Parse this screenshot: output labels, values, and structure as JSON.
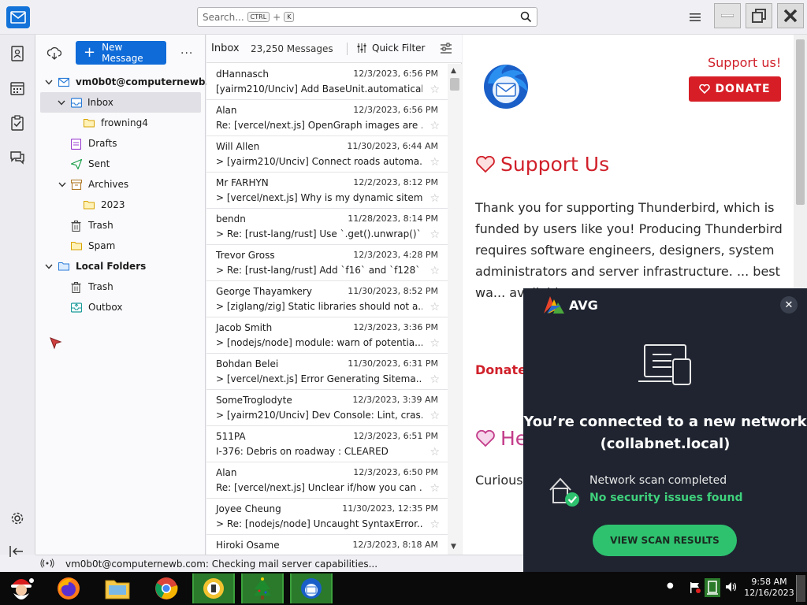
{
  "search": {
    "placeholder": "Search...",
    "key1": "CTRL",
    "plus": "+",
    "key2": "K"
  },
  "folders": {
    "new_message_label": "New Message",
    "more_label": "...",
    "items": [
      {
        "label": "vm0b0t@computernewb...",
        "bold": true
      },
      {
        "label": "Inbox"
      },
      {
        "label": "frowning4"
      },
      {
        "label": "Drafts"
      },
      {
        "label": "Sent"
      },
      {
        "label": "Archives"
      },
      {
        "label": "2023"
      },
      {
        "label": "Trash"
      },
      {
        "label": "Spam"
      },
      {
        "label": "Local Folders",
        "bold": true
      },
      {
        "label": "Trash"
      },
      {
        "label": "Outbox"
      }
    ]
  },
  "list": {
    "title": "Inbox",
    "count": "23,250 Messages",
    "quick_filter": "Quick Filter",
    "messages": [
      {
        "sender": "dHannasch",
        "date": "12/3/2023, 6:56 PM",
        "subject": "[yairm210/Unciv] Add BaseUnit.automatical..."
      },
      {
        "sender": "Alan",
        "date": "12/3/2023, 6:56 PM",
        "subject": "Re: [vercel/next.js] OpenGraph images are ..."
      },
      {
        "sender": "Will Allen",
        "date": "11/30/2023, 6:44 AM",
        "subject": "> [yairm210/Unciv] Connect roads automa..."
      },
      {
        "sender": "Mr FARHYN",
        "date": "12/2/2023, 8:12 PM",
        "subject": "> [vercel/next.js] Why is my dynamic sitem..."
      },
      {
        "sender": "bendn",
        "date": "11/28/2023, 8:14 PM",
        "subject": "> Re: [rust-lang/rust] Use `.get().unwrap()` i..."
      },
      {
        "sender": "Trevor Gross",
        "date": "12/3/2023, 4:28 PM",
        "subject": "> Re: [rust-lang/rust] Add `f16` and `f128` (..."
      },
      {
        "sender": "George Thayamkery",
        "date": "11/30/2023, 8:52 PM",
        "subject": "> [ziglang/zig] Static libraries should not a..."
      },
      {
        "sender": "Jacob Smith",
        "date": "12/3/2023, 3:36 PM",
        "subject": "> [nodejs/node] module: warn of potentia..."
      },
      {
        "sender": "Bohdan Belei",
        "date": "11/30/2023, 6:31 PM",
        "subject": "> [vercel/next.js] Error Generating Sitema..."
      },
      {
        "sender": "SomeTroglodyte",
        "date": "12/3/2023, 3:39 AM",
        "subject": "> [yairm210/Unciv] Dev Console: Lint, cras..."
      },
      {
        "sender": "511PA",
        "date": "12/3/2023, 6:51 PM",
        "subject": "I-376: Debris on roadway : CLEARED"
      },
      {
        "sender": "Alan",
        "date": "12/3/2023, 6:50 PM",
        "subject": "Re: [vercel/next.js] Unclear if/how you can ..."
      },
      {
        "sender": "Joyee Cheung",
        "date": "11/30/2023, 12:35 PM",
        "subject": "> Re: [nodejs/node] Uncaught SyntaxError..."
      },
      {
        "sender": "Hiroki Osame",
        "date": "12/3/2023, 8:18 AM",
        "subject": ""
      }
    ]
  },
  "content": {
    "support_top": "Support us!",
    "donate_button": "DONATE",
    "support_heading": "Support Us",
    "support_body": "Thank you for supporting Thunderbird, which is funded by users like you! Producing Thunderbird requires software engineers, designers, system administrators and server infrastructure. ... best wa... availabl...",
    "donate_link": "Donate",
    "help_heading": "He",
    "help_body": "Curious... expert c... or offer... experie..."
  },
  "status": {
    "text": "vm0b0t@computernewb.com: Checking mail server capabilities..."
  },
  "avg": {
    "logo": "AVG",
    "headline": "You’re connected to a new network (collabnet.local)",
    "scan_title": "Network scan completed",
    "scan_status": "No security issues found",
    "scan_button": "VIEW SCAN RESULTS"
  },
  "taskbar": {
    "time": "9:58 AM",
    "date": "12/16/2023"
  },
  "colors": {
    "accent": "#0f6bd8",
    "donate": "#d71e26",
    "avg_green": "#2ec26f",
    "avg_bg": "#1f2430"
  }
}
